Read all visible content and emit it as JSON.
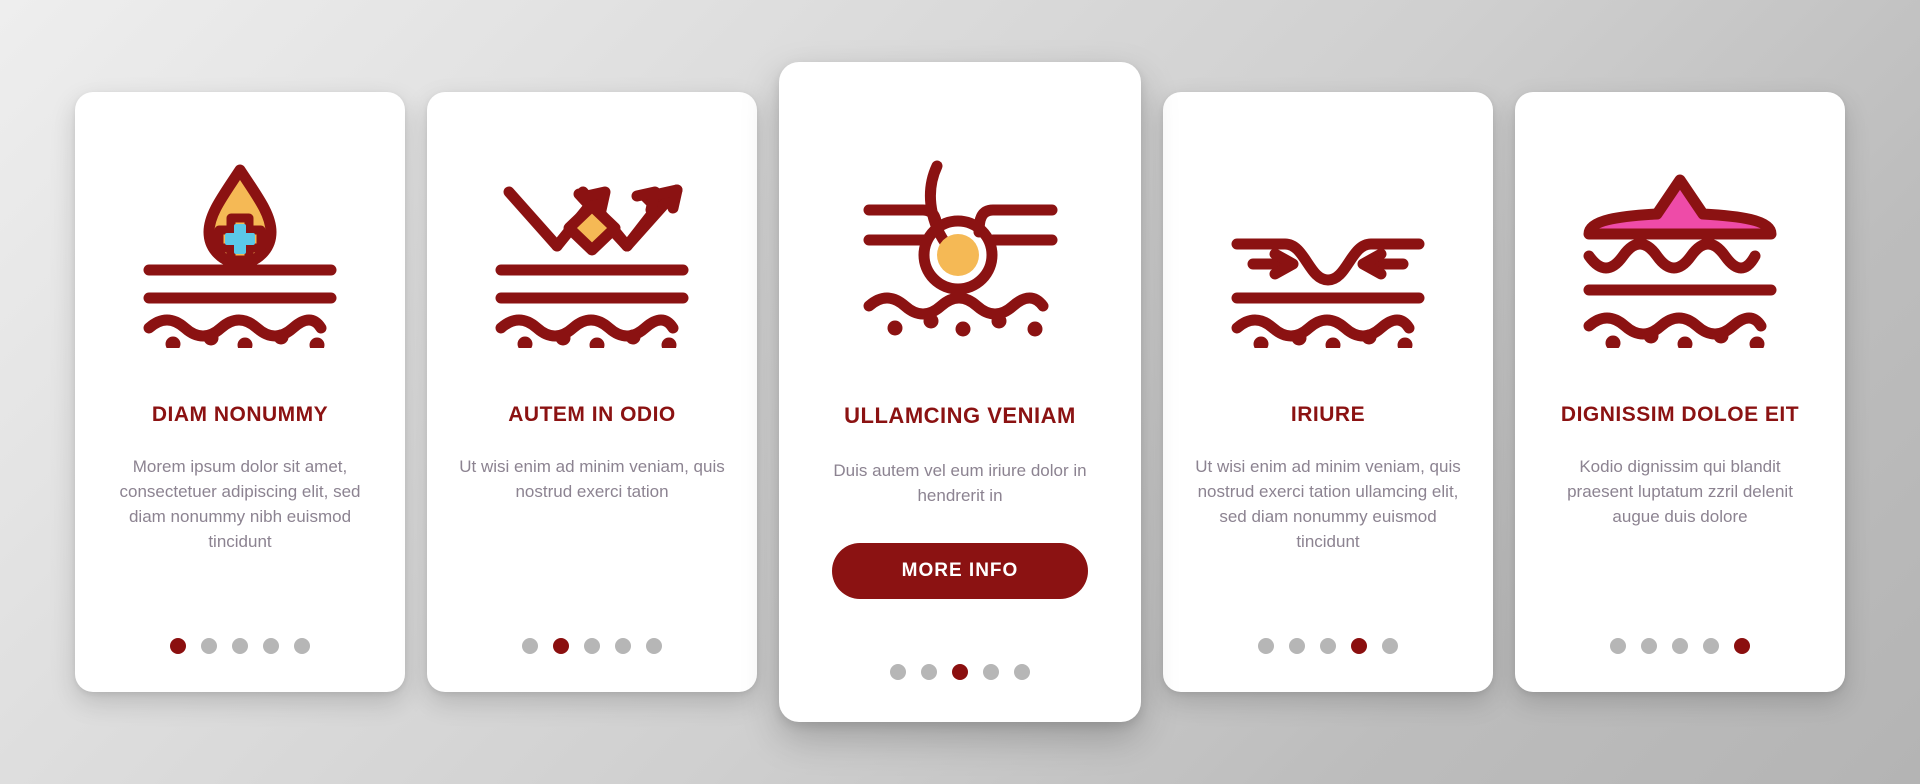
{
  "theme": {
    "dark_red": "#8B1212",
    "active_dot": "#8B0F0F",
    "inactive_dot": "#B6B6B6",
    "body_text": "#8C8391",
    "card_bg": "#FFFFFF",
    "orange": "#F5B955",
    "cyan": "#5BC8E8",
    "pink": "#EE4BA8"
  },
  "cards": [
    {
      "icon": "skin-blood-drop-medical-cross-icon",
      "title": "DIAM NONUMMY",
      "body": "Morem ipsum dolor sit amet, consectetuer adipiscing elit, sed diam nonummy nibh euismod tincidunt",
      "dots": {
        "count": 5,
        "active": 1
      },
      "featured": false,
      "button_label": null
    },
    {
      "icon": "skin-uv-ray-reflection-icon",
      "title": "AUTEM IN ODIO",
      "body": "Ut wisi enim ad minim veniam, quis nostrud exerci tation",
      "dots": {
        "count": 5,
        "active": 2
      },
      "featured": false,
      "button_label": null
    },
    {
      "icon": "skin-hair-follicle-icon",
      "title": "ULLAMCING VENIAM",
      "body": "Duis autem vel eum iriure dolor in hendrerit in",
      "dots": {
        "count": 5,
        "active": 3
      },
      "featured": true,
      "button_label": "MORE INFO"
    },
    {
      "icon": "skin-wrinkle-compression-arrows-icon",
      "title": "IRIURE",
      "body": "Ut wisi enim ad minim veniam, quis nostrud exerci tation ullamcing elit, sed diam nonummy euismod tincidunt",
      "dots": {
        "count": 5,
        "active": 4
      },
      "featured": false,
      "button_label": null
    },
    {
      "icon": "skin-raised-bump-swelling-icon",
      "title": "DIGNISSIM DOLOE EIT",
      "body": "Kodio dignissim qui blandit praesent luptatum zzril delenit augue duis dolore",
      "dots": {
        "count": 5,
        "active": 5
      },
      "featured": false,
      "button_label": null
    }
  ]
}
